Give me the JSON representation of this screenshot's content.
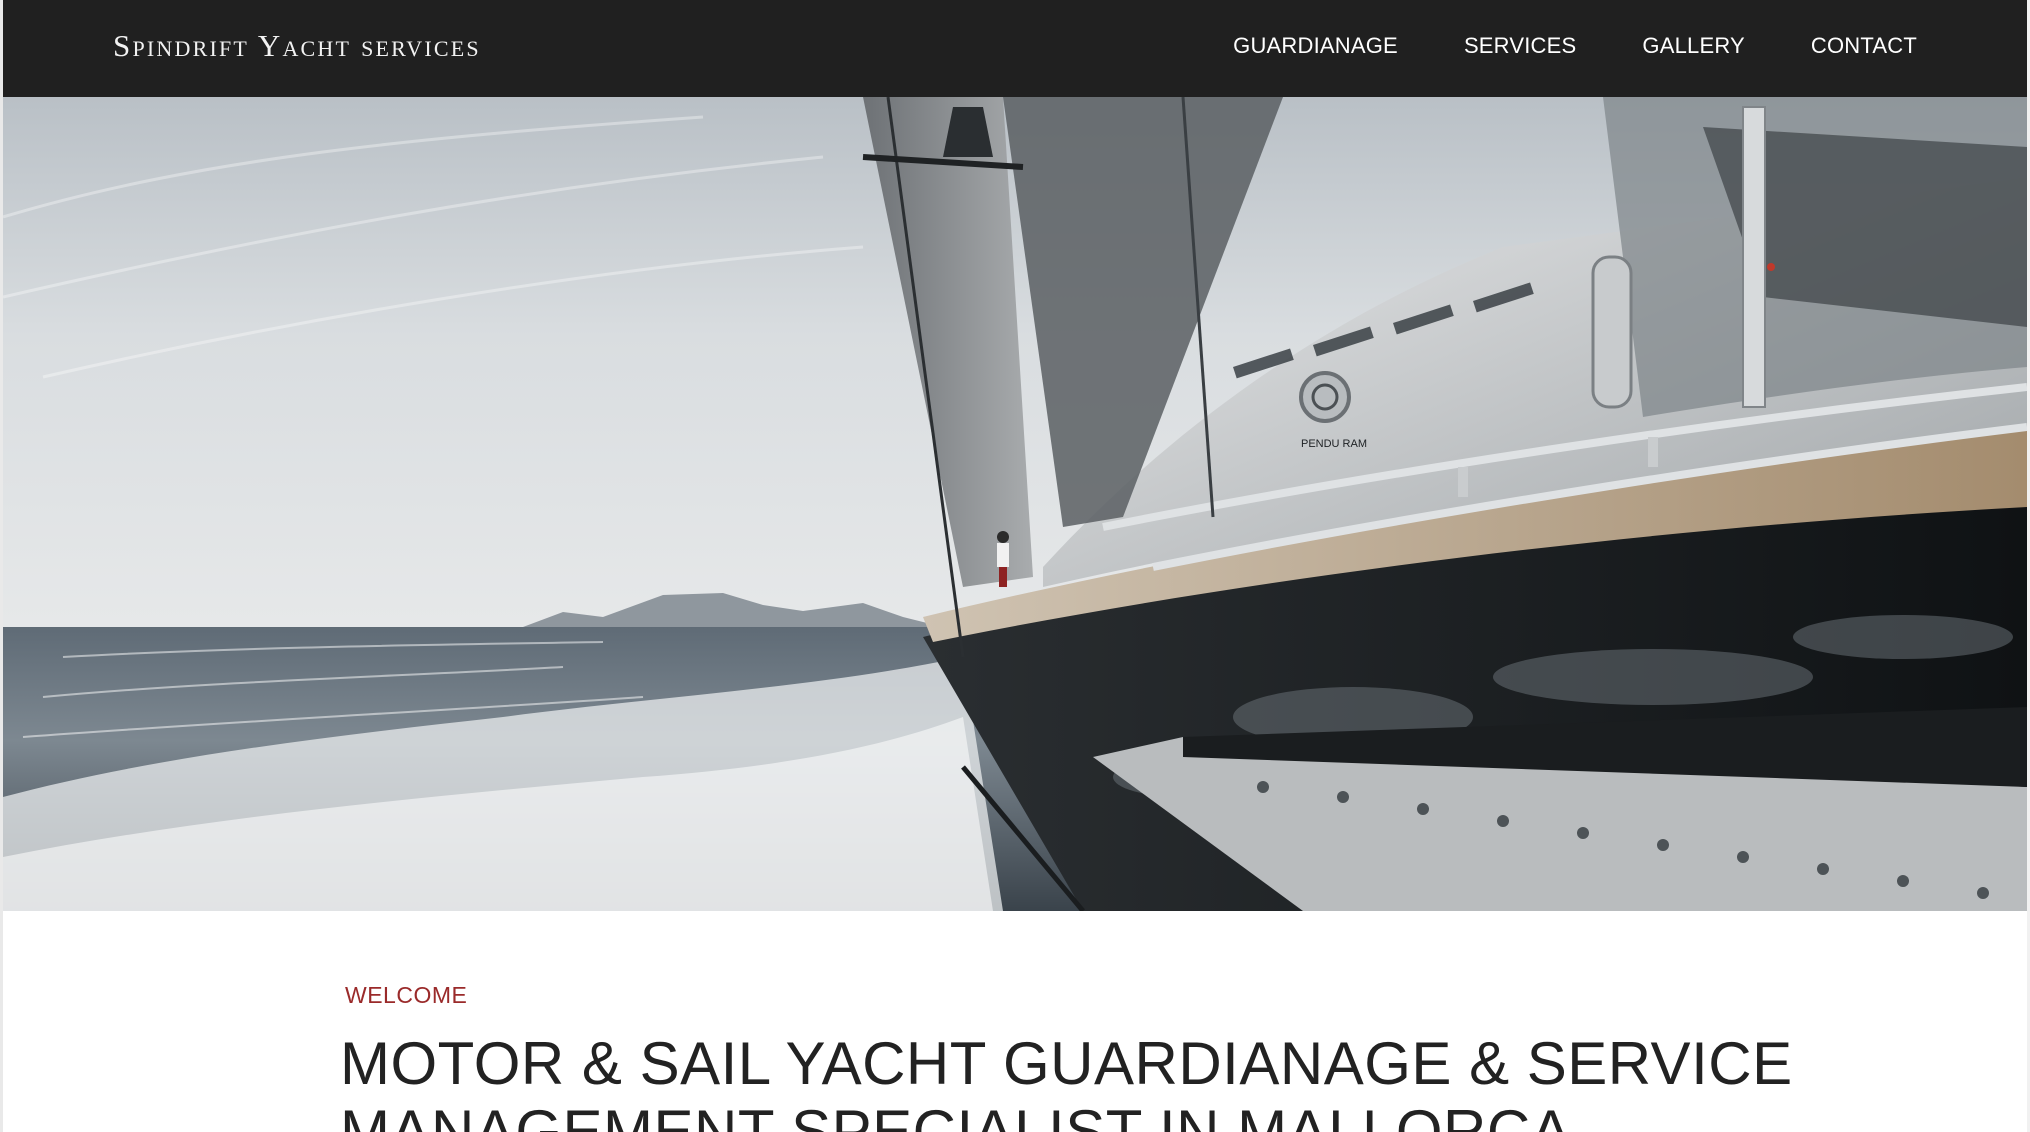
{
  "header": {
    "brand": "Spindrift Yacht services",
    "nav": [
      {
        "label": "GUARDIANAGE"
      },
      {
        "label": "SERVICES"
      },
      {
        "label": "GALLERY"
      },
      {
        "label": "CONTACT"
      }
    ]
  },
  "hero": {
    "hull_text": "PENDU RAM"
  },
  "main": {
    "eyebrow": "WELCOME",
    "headline": "MOTOR & SAIL YACHT GUARDIANAGE & SERVICE MANAGEMENT SPECIALIST IN MALLORCA"
  },
  "colors": {
    "header_bg": "#202020",
    "accent": "#9a2a2a",
    "text": "#222222"
  }
}
